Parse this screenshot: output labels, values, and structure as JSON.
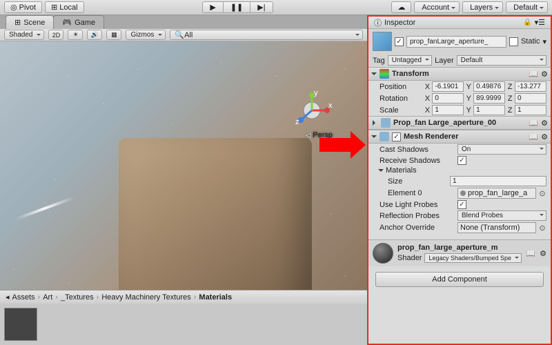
{
  "toolbar": {
    "pivot": "Pivot",
    "local": "Local",
    "account": "Account",
    "layers": "Layers",
    "layout": "Default"
  },
  "tabs": {
    "scene": "Scene",
    "game": "Game"
  },
  "sceneBar": {
    "shaded": "Shaded",
    "twoD": "2D",
    "gizmos": "Gizmos",
    "search": "All"
  },
  "viewport": {
    "persp": "Persp",
    "axes": {
      "x": "x",
      "y": "y",
      "z": "z"
    }
  },
  "breadcrumb": [
    "Assets",
    "Art",
    "_Textures",
    "Heavy Machinery Textures",
    "Materials"
  ],
  "inspector": {
    "tab": "Inspector",
    "objectName": "prop_fanLarge_aperture_",
    "static": "Static",
    "tagLabel": "Tag",
    "tag": "Untagged",
    "layerLabel": "Layer",
    "layer": "Default",
    "transform": {
      "title": "Transform",
      "position": {
        "label": "Position",
        "x": "-6.1901",
        "y": "0.49876",
        "z": "-13.277"
      },
      "rotation": {
        "label": "Rotation",
        "x": "0",
        "y": "89.9999",
        "z": "0"
      },
      "scale": {
        "label": "Scale",
        "x": "1",
        "y": "1",
        "z": "1"
      }
    },
    "meshFilter": {
      "title": "Prop_fan Large_aperture_00"
    },
    "meshRenderer": {
      "title": "Mesh Renderer",
      "castShadows": {
        "label": "Cast Shadows",
        "value": "On"
      },
      "receiveShadows": {
        "label": "Receive Shadows"
      },
      "materials": {
        "label": "Materials",
        "size": {
          "label": "Size",
          "value": "1"
        },
        "element0": {
          "label": "Element 0",
          "value": "prop_fan_large_a"
        }
      },
      "useLightProbes": {
        "label": "Use Light Probes"
      },
      "reflectionProbes": {
        "label": "Reflection Probes",
        "value": "Blend Probes"
      },
      "anchorOverride": {
        "label": "Anchor Override",
        "value": "None (Transform)"
      }
    },
    "material": {
      "name": "prop_fan_large_aperture_m",
      "shaderLabel": "Shader",
      "shader": "Legacy Shaders/Bumped Spe"
    },
    "addComponent": "Add Component"
  }
}
